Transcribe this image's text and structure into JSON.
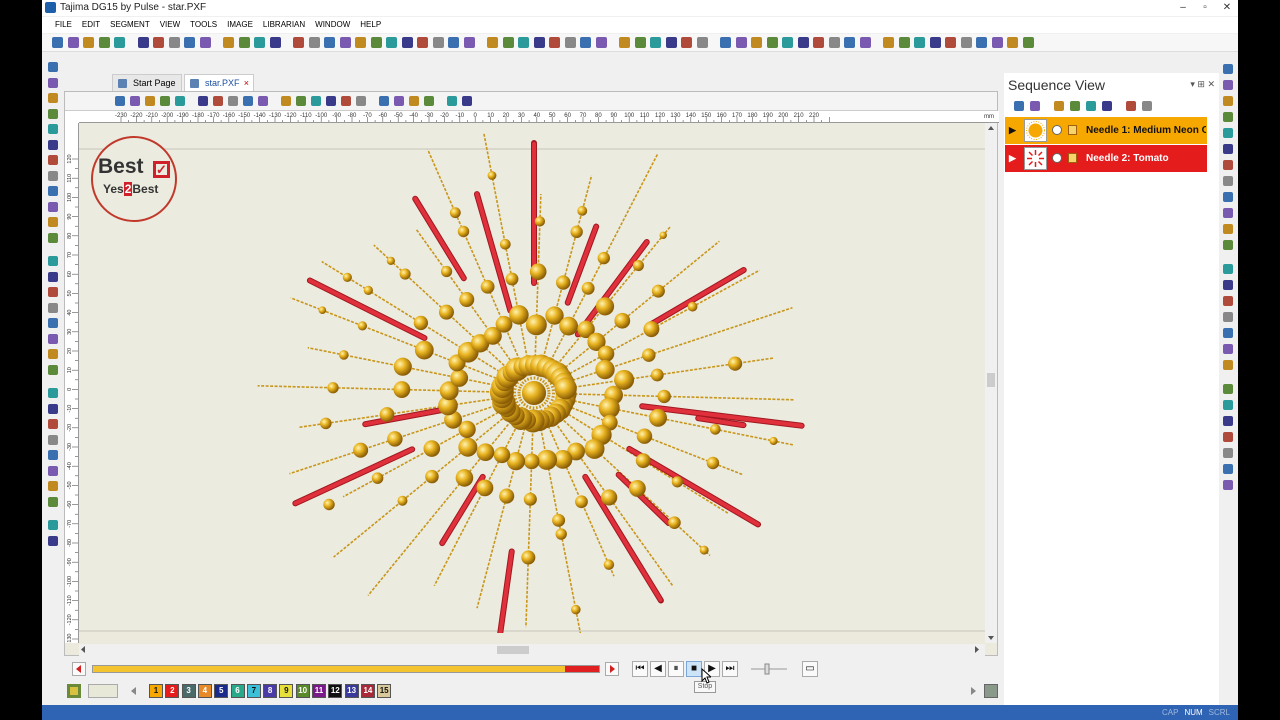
{
  "window": {
    "title": "Tajima DG15 by Pulse - star.PXF",
    "controls": [
      "–",
      "▫",
      "✕"
    ]
  },
  "menu": [
    "FILE",
    "EDIT",
    "SEGMENT",
    "VIEW",
    "TOOLS",
    "IMAGE",
    "LIBRARIAN",
    "WINDOW",
    "HELP"
  ],
  "tabs": [
    {
      "label": "Start Page"
    },
    {
      "label": "star.PXF",
      "active": true,
      "close": "×"
    }
  ],
  "ruler": {
    "unit": "mm",
    "h_ticks": [
      "-230",
      "-220",
      "-210",
      "-200",
      "-190",
      "-180",
      "-170",
      "-160",
      "-150",
      "-140",
      "-130",
      "-120",
      "-110",
      "-100",
      "-90",
      "-80",
      "-70",
      "-60",
      "-50",
      "-40",
      "-30",
      "-20",
      "-10",
      "0",
      "10",
      "20",
      "30",
      "40",
      "50",
      "60",
      "70",
      "80",
      "90",
      "100",
      "110",
      "120",
      "130",
      "140",
      "150",
      "160",
      "170",
      "180",
      "190",
      "200",
      "210",
      "220"
    ],
    "v_ticks": [
      "120",
      "110",
      "100",
      "90",
      "80",
      "70",
      "60",
      "50",
      "40",
      "30",
      "20",
      "10",
      "0",
      "-10",
      "-20",
      "-30",
      "-40",
      "-50",
      "-60",
      "-70",
      "-80",
      "-90",
      "-100",
      "-110",
      "-120",
      "-130"
    ]
  },
  "logo": {
    "line1": "Best",
    "check": "✓",
    "line2_a": "Yes",
    "line2_b": "2",
    "line2_c": "Best"
  },
  "sequence": {
    "title": "Sequence View",
    "controls": "▾ ⊞ ✕",
    "needles": [
      {
        "label": "Needle 1: Medium Neon O",
        "color": "#f6a800",
        "text_color": "#111111"
      },
      {
        "label": "Needle 2: Tomato",
        "color": "#e41c1c",
        "text_color": "#ffffff"
      }
    ]
  },
  "playback": {
    "progress_percent": 99,
    "buttons": [
      "⏮",
      "◀",
      "⏸",
      "■",
      "▶",
      "⏭"
    ],
    "tooltip": "Stop"
  },
  "palette": [
    {
      "n": "1",
      "color": "#f6a800"
    },
    {
      "n": "2",
      "color": "#e41c1c"
    },
    {
      "n": "3",
      "color": "#4a6a6a"
    },
    {
      "n": "4",
      "color": "#e88a2a"
    },
    {
      "n": "5",
      "color": "#1a2a8a"
    },
    {
      "n": "6",
      "color": "#2aa88a"
    },
    {
      "n": "7",
      "color": "#3cc0d8"
    },
    {
      "n": "8",
      "color": "#4a3aa8"
    },
    {
      "n": "9",
      "color": "#e8e03a"
    },
    {
      "n": "10",
      "color": "#5a8a2a"
    },
    {
      "n": "11",
      "color": "#7a1a8a"
    },
    {
      "n": "12",
      "color": "#111111"
    },
    {
      "n": "13",
      "color": "#3a3a9a"
    },
    {
      "n": "14",
      "color": "#a82a3a"
    },
    {
      "n": "15",
      "color": "#d8c89a"
    }
  ],
  "status": {
    "items": [
      "CAP",
      "NUM",
      "SCRL"
    ]
  },
  "colors": {
    "gold": "#d9a21b",
    "red": "#e0303c",
    "canvas": "#ecebdf"
  }
}
